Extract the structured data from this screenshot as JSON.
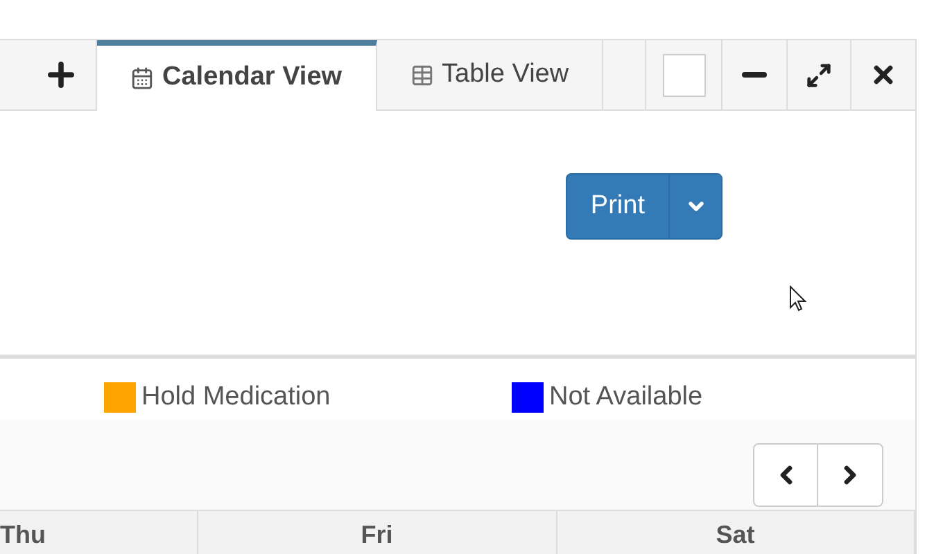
{
  "tabs": [
    {
      "label": "Calendar View",
      "kind": "calendar",
      "selected": true
    },
    {
      "label": "Table View",
      "kind": "table",
      "selected": false
    }
  ],
  "print_button": {
    "label": "Print"
  },
  "legend": [
    {
      "label": "Hold Medication",
      "color": "#ffa500"
    },
    {
      "label": "Not Available",
      "color": "#0000ff"
    }
  ],
  "day_headers": [
    "Thu",
    "Fri",
    "Sat"
  ]
}
